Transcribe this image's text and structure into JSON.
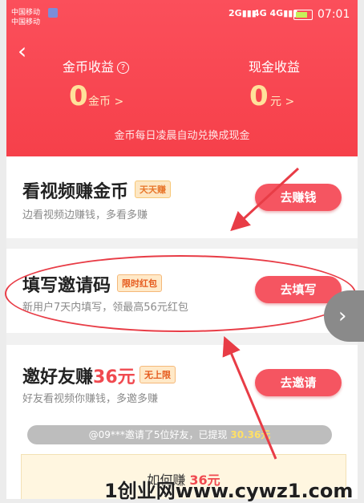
{
  "status_bar": {
    "carrier1": "中国移动",
    "carrier2": "中国移动",
    "net1": "2G",
    "net2": "4G",
    "net3": "4G",
    "time": "07:01"
  },
  "header": {
    "back": "‹",
    "coin_label": "金币收益",
    "help": "?",
    "cash_label": "现金收益",
    "coin_value": "0",
    "coin_unit": "金币 >",
    "cash_value": "0",
    "cash_unit": "元 >",
    "note": "金币每日凌晨自动兑换成现金"
  },
  "tasks": [
    {
      "title": "看视频赚金币",
      "tag": "天天赚",
      "desc": "边看视频边赚钱，多看多赚",
      "button": "去赚钱"
    },
    {
      "title": "填写邀请码",
      "tag": "限时红包",
      "desc": "新用户7天内填写，领最高56元红包",
      "button": "去填写"
    },
    {
      "title": "邀好友赚",
      "title_amount": "36元",
      "tag": "无上限",
      "desc": "好友看视频你赚钱，多邀多赚",
      "button": "去邀请"
    }
  ],
  "invite_notice": {
    "text": "@09***邀请了5位好友，已提现 ",
    "amount": "30.36元"
  },
  "how": {
    "text": "如何赚 ",
    "amount": "36元"
  },
  "side_tab": "›",
  "watermark": "1创业网www.cywz1.com",
  "colors": {
    "header": "#f6404a",
    "button": "#f55561",
    "annotation": "#e83c46"
  }
}
